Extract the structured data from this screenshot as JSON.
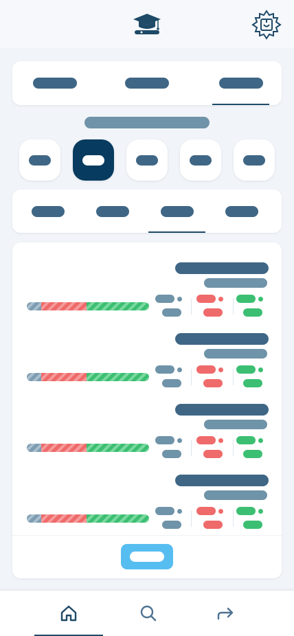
{
  "header": {
    "logo_icon": "graduation-cap-icon",
    "corner_icon": "ornament-badge-icon"
  },
  "top_tabs": [
    {
      "active": false
    },
    {
      "active": false
    },
    {
      "active": true
    }
  ],
  "filter_chips": [
    {
      "active": false
    },
    {
      "active": true
    },
    {
      "active": false
    },
    {
      "active": false
    },
    {
      "active": false
    }
  ],
  "sub_tabs": [
    {
      "active": false
    },
    {
      "active": false
    },
    {
      "active": true
    },
    {
      "active": false
    }
  ],
  "rows": [
    {
      "progress": {
        "grey": 0.12,
        "red": 0.37,
        "green": 0.51
      }
    },
    {
      "progress": {
        "grey": 0.12,
        "red": 0.37,
        "green": 0.51
      }
    },
    {
      "progress": {
        "grey": 0.12,
        "red": 0.37,
        "green": 0.51
      }
    },
    {
      "progress": {
        "grey": 0.12,
        "red": 0.37,
        "green": 0.51
      }
    }
  ],
  "bottom_nav": [
    {
      "icon": "home-icon",
      "active": true
    },
    {
      "icon": "search-icon",
      "active": false
    },
    {
      "icon": "share-arrow-icon",
      "active": false
    }
  ],
  "colors": {
    "primary_dark": "#073b5f",
    "label_dark": "#3f6685",
    "label_grey": "#6f93a8",
    "accent_blue": "#56bdf0",
    "status_red": "#ef6a6a",
    "status_green": "#3cbf72"
  }
}
